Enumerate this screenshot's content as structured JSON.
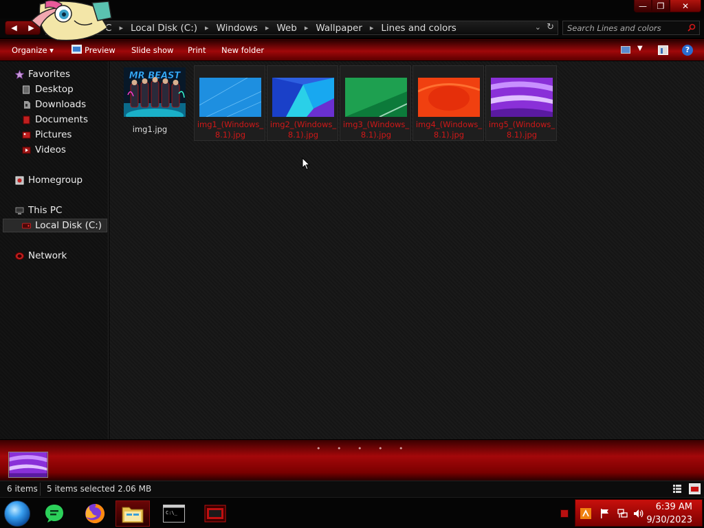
{
  "address": {
    "segments": [
      "C",
      "Local Disk (C:)",
      "Windows",
      "Web",
      "Wallpaper",
      "Lines and colors"
    ],
    "dropdown_glyph": "⌄",
    "refresh_glyph": "↻"
  },
  "search": {
    "placeholder": "Search Lines and colors"
  },
  "toolbar": {
    "organize": "Organize ▾",
    "preview": "Preview",
    "slideshow": "Slide show",
    "print": "Print",
    "newfolder": "New folder",
    "help": "?"
  },
  "sidebar": {
    "favorites": "Favorites",
    "desktop": "Desktop",
    "downloads": "Downloads",
    "documents": "Documents",
    "pictures": "Pictures",
    "videos": "Videos",
    "homegroup": "Homegroup",
    "thispc": "This PC",
    "localdisk": "Local Disk (C:)",
    "network": "Network"
  },
  "files": [
    {
      "name": "img1.jpg",
      "selected": false
    },
    {
      "name": "img1_(Windows_8.1).jpg",
      "selected": true,
      "color": "#1e8fe0"
    },
    {
      "name": "img2_(Windows_8.1).jpg",
      "selected": true,
      "color": "#2d5fe0"
    },
    {
      "name": "img3_(Windows_8.1).jpg",
      "selected": true,
      "color": "#1ea050"
    },
    {
      "name": "img4_(Windows_8.1).jpg",
      "selected": true,
      "color": "#f04010"
    },
    {
      "name": "img5_(Windows_8.1).jpg",
      "selected": true,
      "color": "#8a30d8"
    }
  ],
  "thumb_text": "MR BEAST",
  "details": {
    "dots": "• • • • •"
  },
  "status": {
    "count": "6 items",
    "selection": "5 items selected  2.06 MB"
  },
  "taskbar": {
    "time": "6:39 AM",
    "date": "9/30/2023",
    "cmd_prompt": "C:\\_"
  },
  "colors": {
    "accent_red": "#a0080a",
    "selection_text": "#d01818"
  }
}
